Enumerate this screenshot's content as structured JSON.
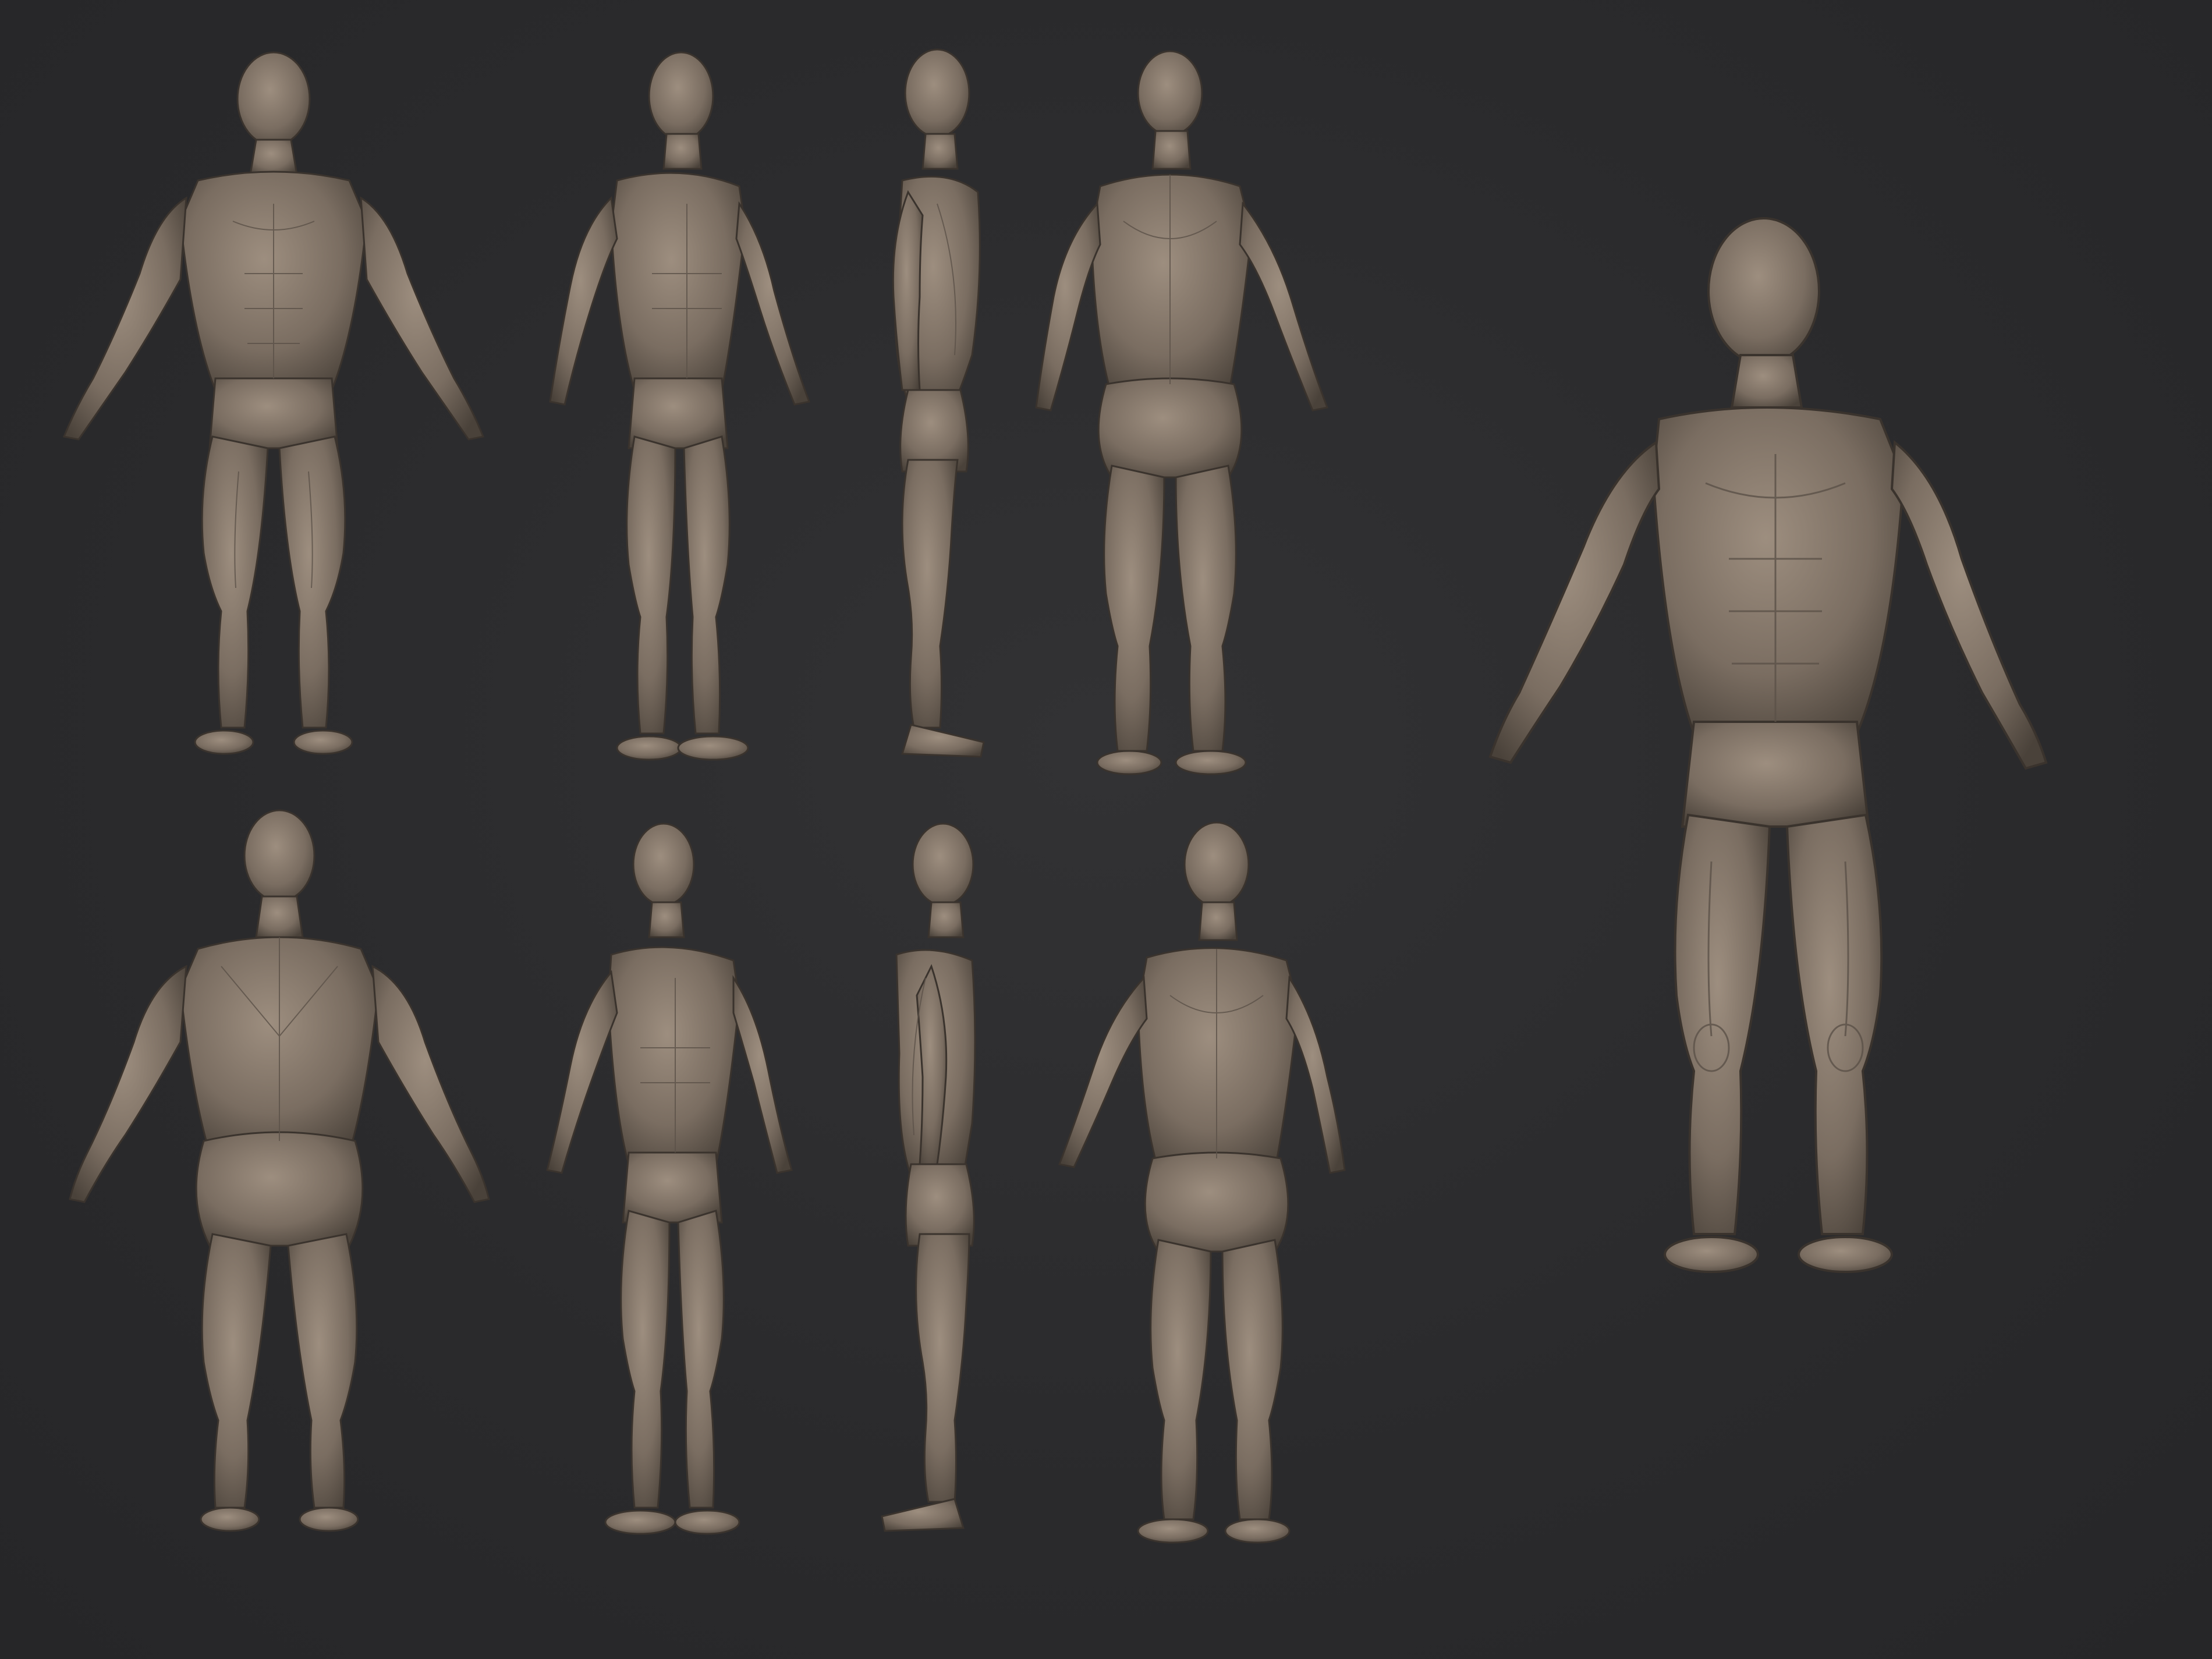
{
  "scene": {
    "background_color": "#2b2b2d",
    "material_color": "#7d7064",
    "material_highlight": "#9a8b7c",
    "material_shadow": "#4e453d"
  },
  "figures": [
    {
      "id": "fig-1",
      "view": "front",
      "arms": "a-pose"
    },
    {
      "id": "fig-2",
      "view": "three-quarter-front-left",
      "arms": "down"
    },
    {
      "id": "fig-3",
      "view": "side-right",
      "arms": "down"
    },
    {
      "id": "fig-4",
      "view": "three-quarter-back",
      "arms": "a-pose"
    },
    {
      "id": "fig-5",
      "view": "back",
      "arms": "a-pose"
    },
    {
      "id": "fig-6",
      "view": "three-quarter-front-left",
      "arms": "down"
    },
    {
      "id": "fig-7",
      "view": "side-left",
      "arms": "down"
    },
    {
      "id": "fig-8",
      "view": "three-quarter-back-left",
      "arms": "a-pose"
    },
    {
      "id": "fig-9",
      "view": "perspective-front",
      "arms": "a-pose"
    }
  ]
}
